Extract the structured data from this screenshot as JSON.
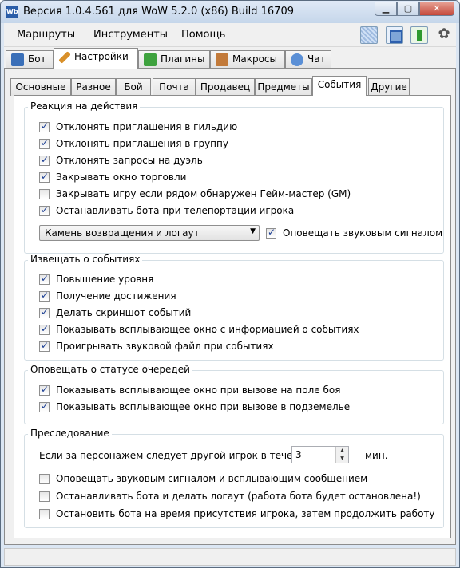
{
  "window": {
    "title": "Версия 1.0.4.561 для WoW 5.2.0 (x86) Build 16709",
    "app_icon_text": "Wb"
  },
  "menu": {
    "items": [
      "Маршруты",
      "Инструменты",
      "Помощь"
    ]
  },
  "toolbar": {
    "icons": [
      "pattern-icon",
      "frame-icon",
      "upload-arrow-icon",
      "settings-flower-icon"
    ]
  },
  "top_tabs": [
    {
      "label": "Бот",
      "icon": "monitor-icon",
      "active": false
    },
    {
      "label": "Настройки",
      "icon": "wrench-icon",
      "active": true
    },
    {
      "label": "Плагины",
      "icon": "puzzle-icon",
      "active": false
    },
    {
      "label": "Макросы",
      "icon": "pencil-icon",
      "active": false
    },
    {
      "label": "Чат",
      "icon": "user-icon",
      "active": false
    }
  ],
  "sub_tabs": [
    {
      "label": "Основные",
      "active": false
    },
    {
      "label": "Разное",
      "active": false
    },
    {
      "label": "Бой",
      "active": false
    },
    {
      "label": "Почта",
      "active": false
    },
    {
      "label": "Продавец",
      "active": false
    },
    {
      "label": "Предметы",
      "active": false
    },
    {
      "label": "События",
      "active": true
    },
    {
      "label": "Другие",
      "active": false
    }
  ],
  "groups": {
    "reaction": {
      "title": "Реакция на действия",
      "items": [
        {
          "label": "Отклонять приглашения в гильдию",
          "checked": true
        },
        {
          "label": "Отклонять приглашения в группу",
          "checked": true
        },
        {
          "label": "Отклонять запросы на дуэль",
          "checked": true
        },
        {
          "label": "Закрывать окно торговли",
          "checked": true
        },
        {
          "label": "Закрывать игру если рядом обнаружен Гейм-мастер (GM)",
          "checked": false
        },
        {
          "label": "Останавливать бота при телепортации игрока",
          "checked": true
        }
      ],
      "combo_value": "Камень возвращения и логаут",
      "sound_label": "Оповещать звуковым сигналом",
      "sound_checked": true
    },
    "notify": {
      "title": "Извещать о событиях",
      "items": [
        {
          "label": "Повышение уровня",
          "checked": true
        },
        {
          "label": "Получение достижения",
          "checked": true
        },
        {
          "label": "Делать скриншот событий",
          "checked": true
        },
        {
          "label": "Показывать всплывающее окно с информацией о событиях",
          "checked": true
        },
        {
          "label": "Проигрывать звуковой файл при событиях",
          "checked": true
        }
      ]
    },
    "queue": {
      "title": "Оповещать о статусе очередей",
      "items": [
        {
          "label": "Показывать всплывающее окно при вызове на поле боя",
          "checked": true
        },
        {
          "label": "Показывать всплывающее окно при вызове в подземелье",
          "checked": true
        }
      ]
    },
    "pursuit": {
      "title": "Преследование",
      "follow_label": "Если за персонажем следует другой игрок в течении:",
      "follow_value": "3",
      "follow_unit": "мин.",
      "items": [
        {
          "label": "Оповещать звуковым сигналом и всплывающим сообщением",
          "checked": false
        },
        {
          "label": "Останавливать бота и делать логаут (работа бота будет остановлена!)",
          "checked": false
        },
        {
          "label": "Остановить бота на время присутствия игрока, затем продолжить работу",
          "checked": false
        }
      ]
    }
  },
  "colors": {
    "window_frame": "#dbe6f3",
    "panel": "#f0f0f0",
    "check_mark": "#1c3f94",
    "group_border": "#d5dfe5"
  }
}
